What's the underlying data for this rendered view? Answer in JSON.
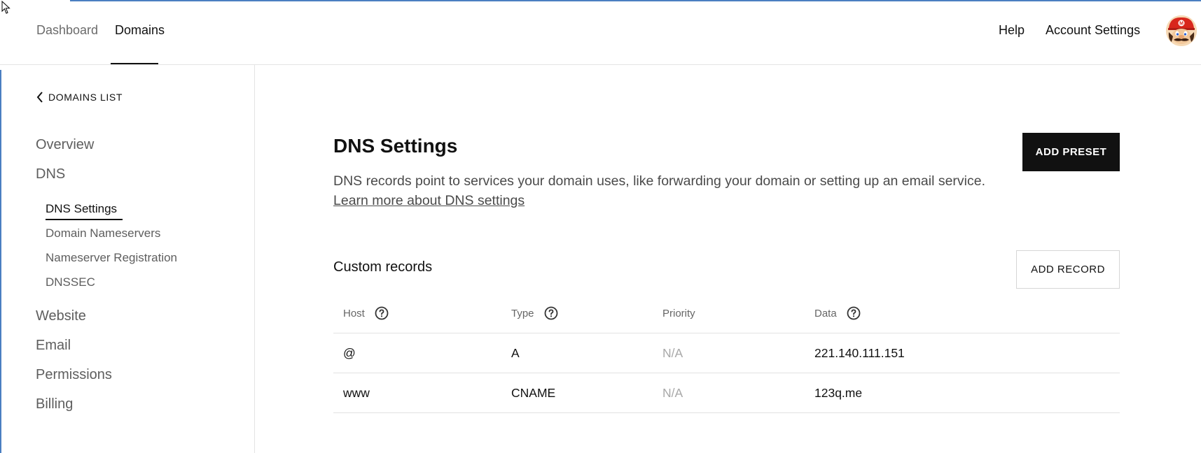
{
  "topnav": {
    "dashboard": "Dashboard",
    "domains": "Domains",
    "help": "Help",
    "account_settings": "Account Settings"
  },
  "sidebar": {
    "back_label": "DOMAINS LIST",
    "items": [
      {
        "label": "Overview"
      },
      {
        "label": "DNS"
      },
      {
        "label": "Website"
      },
      {
        "label": "Email"
      },
      {
        "label": "Permissions"
      },
      {
        "label": "Billing"
      }
    ],
    "dns_subitems": [
      {
        "label": "DNS Settings",
        "active": true
      },
      {
        "label": "Domain Nameservers"
      },
      {
        "label": "Nameserver Registration"
      },
      {
        "label": "DNSSEC"
      }
    ]
  },
  "main": {
    "title": "DNS Settings",
    "description": "DNS records point to services your domain uses, like forwarding your domain or setting up an email service.",
    "learn_more": "Learn more about DNS settings",
    "add_preset": "ADD PRESET",
    "custom_records_title": "Custom records",
    "add_record": "ADD RECORD",
    "table": {
      "headers": [
        "Host",
        "Type",
        "Priority",
        "Data"
      ],
      "rows": [
        {
          "host": "@",
          "type": "A",
          "priority": "N/A",
          "data": "221.140.111.151"
        },
        {
          "host": "www",
          "type": "CNAME",
          "priority": "N/A",
          "data": "123q.me"
        }
      ]
    }
  },
  "icons": {
    "back": "chevron-left-icon",
    "help": "question-circle-icon",
    "avatar": "mario-avatar"
  },
  "colors": {
    "accent_line": "#4a7fc1",
    "primary_button": "#111111",
    "muted_text": "#a8a8a8"
  }
}
